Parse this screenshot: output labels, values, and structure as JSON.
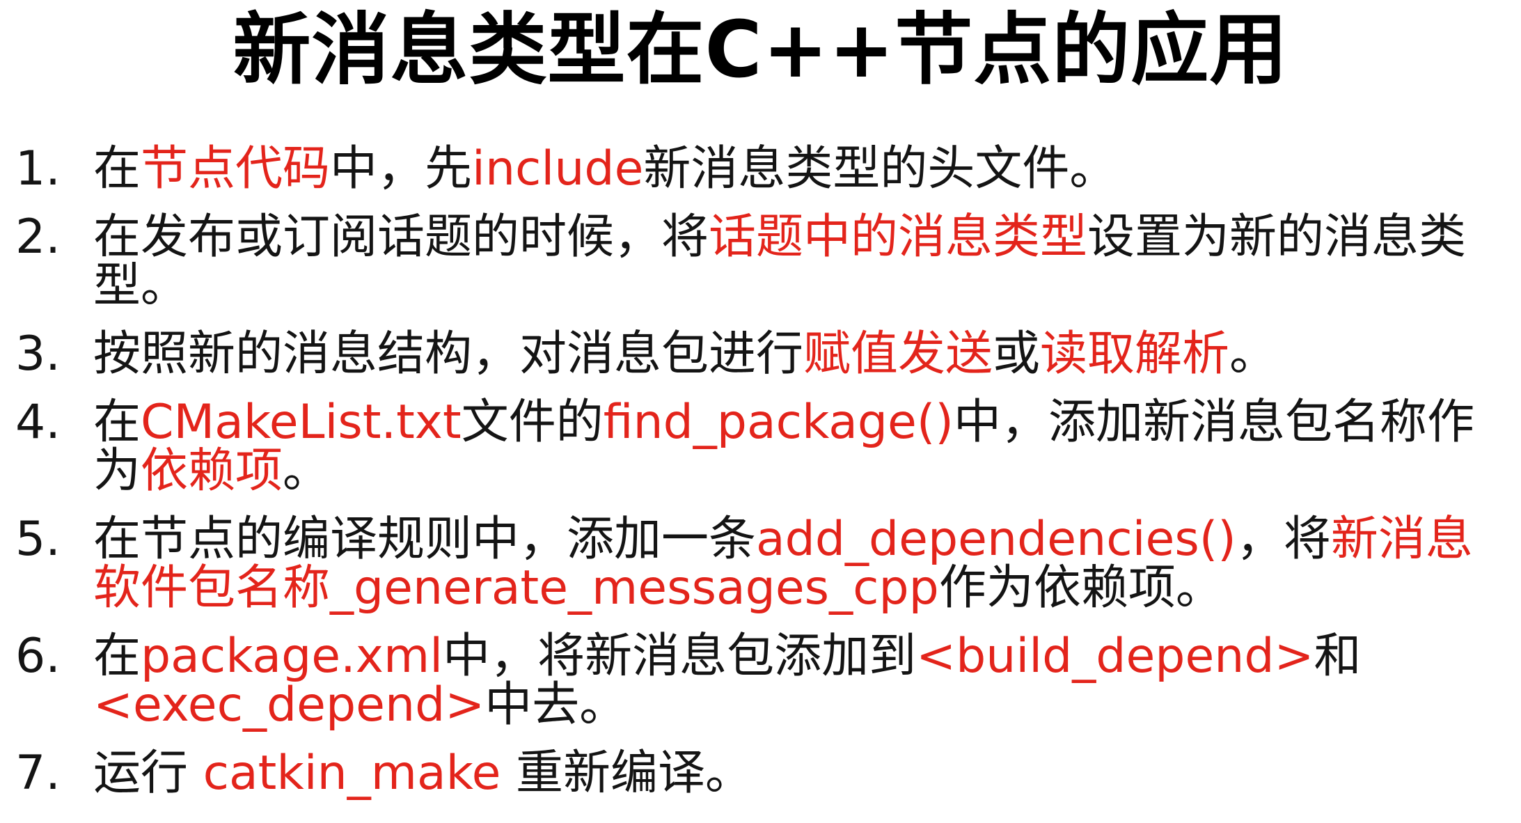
{
  "title": "新消息类型在C++节点的应用",
  "colors": {
    "text": "#141414",
    "highlight": "#e3241b",
    "background": "#ffffff"
  },
  "items": [
    {
      "number": "1.",
      "segments": [
        {
          "text": "在",
          "highlight": false
        },
        {
          "text": "节点代码",
          "highlight": true
        },
        {
          "text": "中，先",
          "highlight": false
        },
        {
          "text": "include",
          "highlight": true
        },
        {
          "text": "新消息类型的头文件。",
          "highlight": false
        }
      ]
    },
    {
      "number": "2.",
      "segments": [
        {
          "text": "在发布或订阅话题的时候，将",
          "highlight": false
        },
        {
          "text": "话题中的消息类型",
          "highlight": true
        },
        {
          "text": "设置为新的消息类型。",
          "highlight": false
        }
      ]
    },
    {
      "number": "3.",
      "segments": [
        {
          "text": "按照新的消息结构，对消息包进行",
          "highlight": false
        },
        {
          "text": "赋值发送",
          "highlight": true
        },
        {
          "text": "或",
          "highlight": false
        },
        {
          "text": "读取解析",
          "highlight": true
        },
        {
          "text": "。",
          "highlight": false
        }
      ]
    },
    {
      "number": "4.",
      "segments": [
        {
          "text": "在",
          "highlight": false
        },
        {
          "text": "CMakeList.txt",
          "highlight": true
        },
        {
          "text": "文件的",
          "highlight": false
        },
        {
          "text": "find_package()",
          "highlight": true
        },
        {
          "text": "中，添加新消息包名称作为",
          "highlight": false
        },
        {
          "text": "依赖项",
          "highlight": true
        },
        {
          "text": "。",
          "highlight": false
        }
      ]
    },
    {
      "number": "5.",
      "segments": [
        {
          "text": "在节点的编译规则中，添加一条",
          "highlight": false
        },
        {
          "text": "add_dependencies()",
          "highlight": true
        },
        {
          "text": "，将",
          "highlight": false
        },
        {
          "text": "新消息软件包名称_generate_messages_cpp",
          "highlight": true
        },
        {
          "text": "作为依赖项。",
          "highlight": false
        }
      ]
    },
    {
      "number": "6.",
      "segments": [
        {
          "text": "在",
          "highlight": false
        },
        {
          "text": "package.xml",
          "highlight": true
        },
        {
          "text": "中，将新消息包添加到",
          "highlight": false
        },
        {
          "text": "<build_depend>",
          "highlight": true
        },
        {
          "text": "和",
          "highlight": false
        },
        {
          "text": "<exec_depend>",
          "highlight": true
        },
        {
          "text": "中去。",
          "highlight": false
        }
      ]
    },
    {
      "number": "7.",
      "segments": [
        {
          "text": "运行 ",
          "highlight": false
        },
        {
          "text": "catkin_make",
          "highlight": true
        },
        {
          "text": " 重新编译。",
          "highlight": false
        }
      ]
    }
  ]
}
